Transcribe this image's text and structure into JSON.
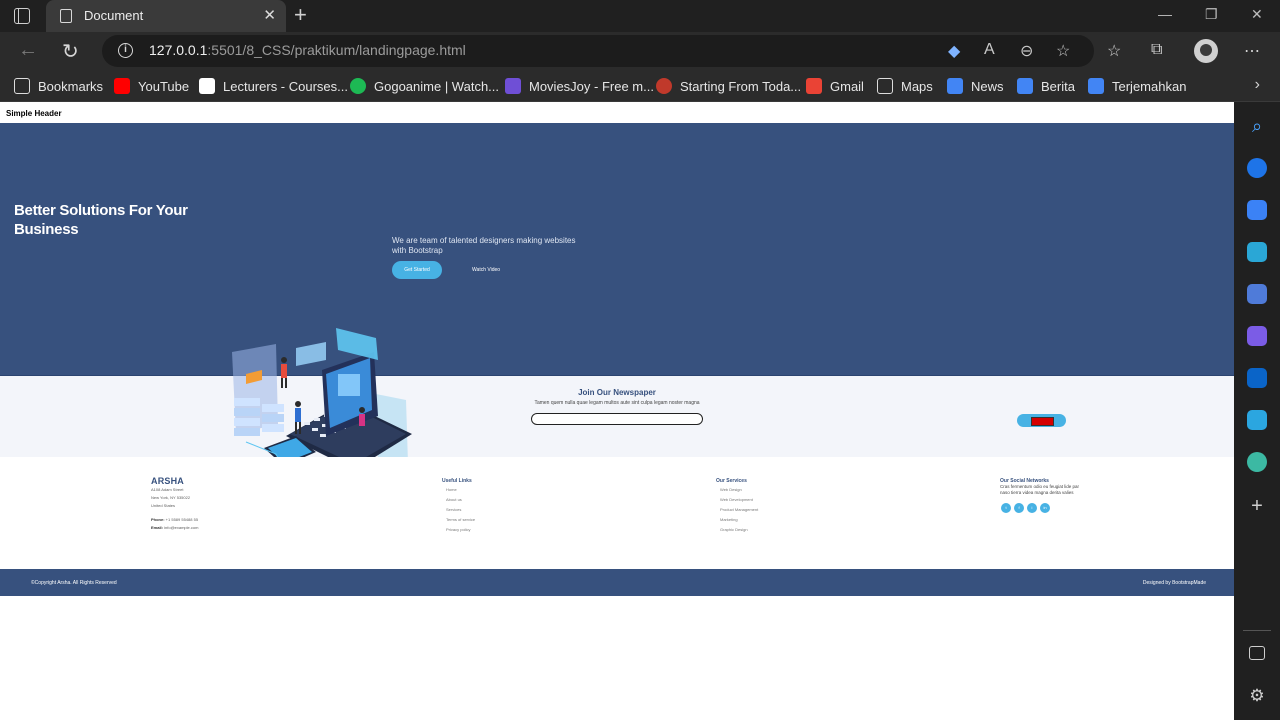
{
  "browser": {
    "tab_title": "Document",
    "url_host": "127.0.0.1",
    "url_rest": ":5501/8_CSS/praktikum/landingpage.html",
    "bookmarks": [
      {
        "label": "Bookmarks",
        "icon": "folder-icon",
        "color": "#e6e6e6"
      },
      {
        "label": "YouTube",
        "icon": "youtube-icon",
        "color": "#ff0000"
      },
      {
        "label": "Lecturers - Courses...",
        "icon": "check-icon",
        "color": "#ffffff"
      },
      {
        "label": "Gogoanime | Watch...",
        "icon": "tv-icon",
        "color": "#1db954"
      },
      {
        "label": "MoviesJoy - Free m...",
        "icon": "film-icon",
        "color": "#6f4fd6"
      },
      {
        "label": "Starting From Toda...",
        "icon": "game-icon",
        "color": "#c0392b"
      },
      {
        "label": "Gmail",
        "icon": "gmail-icon",
        "color": "#ea4335"
      },
      {
        "label": "Maps",
        "icon": "page-icon",
        "color": "#e6e6e6"
      },
      {
        "label": "News",
        "icon": "news-icon",
        "color": "#4285f4"
      },
      {
        "label": "Berita",
        "icon": "news-icon",
        "color": "#4285f4"
      },
      {
        "label": "Terjemahkan",
        "icon": "translate-icon",
        "color": "#4285f4"
      }
    ]
  },
  "page": {
    "header": "Simple Header",
    "hero": {
      "title": "Better Solutions For Your Business",
      "subtitle": "We are team of talented designers making websites with Bootstrap",
      "btn_started": "Get Started",
      "btn_video": "Watch Video"
    },
    "newsletter": {
      "title": "Join Our Newspaper",
      "text": "Tamen quem nulla quae legam multos aute sint culpa legam noster magna"
    },
    "footer": {
      "brand": "ARSHA",
      "address": [
        "A108 Adam Street",
        "New York, NY 535022",
        "United States"
      ],
      "phone_label": "Phone:",
      "phone": " +1 5589 55488 55",
      "email_label": "Email:",
      "email": " info@example.com",
      "useful_title": "Useful Links",
      "useful_links": [
        "Home",
        "About us",
        "Services",
        "Terms of service",
        "Privacy policy"
      ],
      "services_title": "Our Services",
      "services": [
        "Web Design",
        "Web Development",
        "Product Management",
        "Marketing",
        "Graphic Design"
      ],
      "social_title": "Our Social Networks",
      "social_text": "Cras fermentum odio eu feugiat lide par naso tierra videa magna derita valies"
    },
    "copyright": "©Copyright Arsha. All Rights Reserved",
    "designed": "Designed by BootstrapMade"
  },
  "colors": {
    "hero_bg": "#37517e",
    "accent": "#47b2e4",
    "newsletter_bg": "#f3f5fa"
  }
}
